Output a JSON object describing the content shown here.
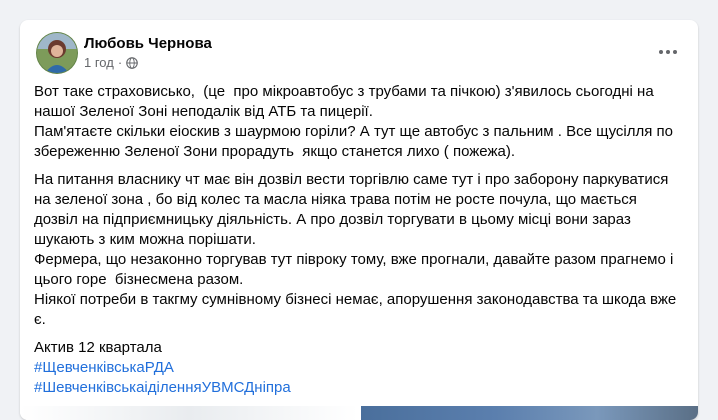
{
  "post": {
    "author_name": "Любовь Чернова",
    "timestamp": "1 год",
    "separator": "·",
    "audience_icon": "globe-icon",
    "more_icon": "more-horizontal-icon",
    "paragraphs": [
      "Вот таке страховисько,  (це  про мікроавтобус з трубами та пічкою) з'явилось сьогодні на нашої Зеленої Зоні неподалік від АТБ та пицерії.\nПам'ятаєте скільки еіоскив з шаурмою горіли? А тут ще автобус з пальним . Все щусілля по збереженню Зеленої Зони прорадуть  якщо станется лихо ( пожежа).",
      "На питання власнику чт має він дозвіл вести торгівлю саме тут і про заборону паркуватися на зеленої зона , бо від колес та масла ніяка трава потім не росте почула, що мається дозвіл на підприємницьку діяльність. А про дозвіл торгувати в цьому місці вони зараз шукають з ким можна порішати.\nФермера, що незаконно торгував тут півроку тому, вже прогнали, давайте разом прагнемо і цього горе  бізнесмена разом.\nНіякої потреби в такгму сумнівному бізнесі немає, апорушення законодавства та шкода вже є.",
      "Актив 12 квартала"
    ],
    "hashtags": [
      "#ЩевченківськаРДА",
      "#ШевченківськаіділенняУВМСДніпра"
    ]
  },
  "colors": {
    "page_background": "#f0f2f5",
    "card_background": "#ffffff",
    "text_primary": "#050505",
    "text_secondary": "#65676b",
    "hashtag_link": "#216fdb"
  }
}
